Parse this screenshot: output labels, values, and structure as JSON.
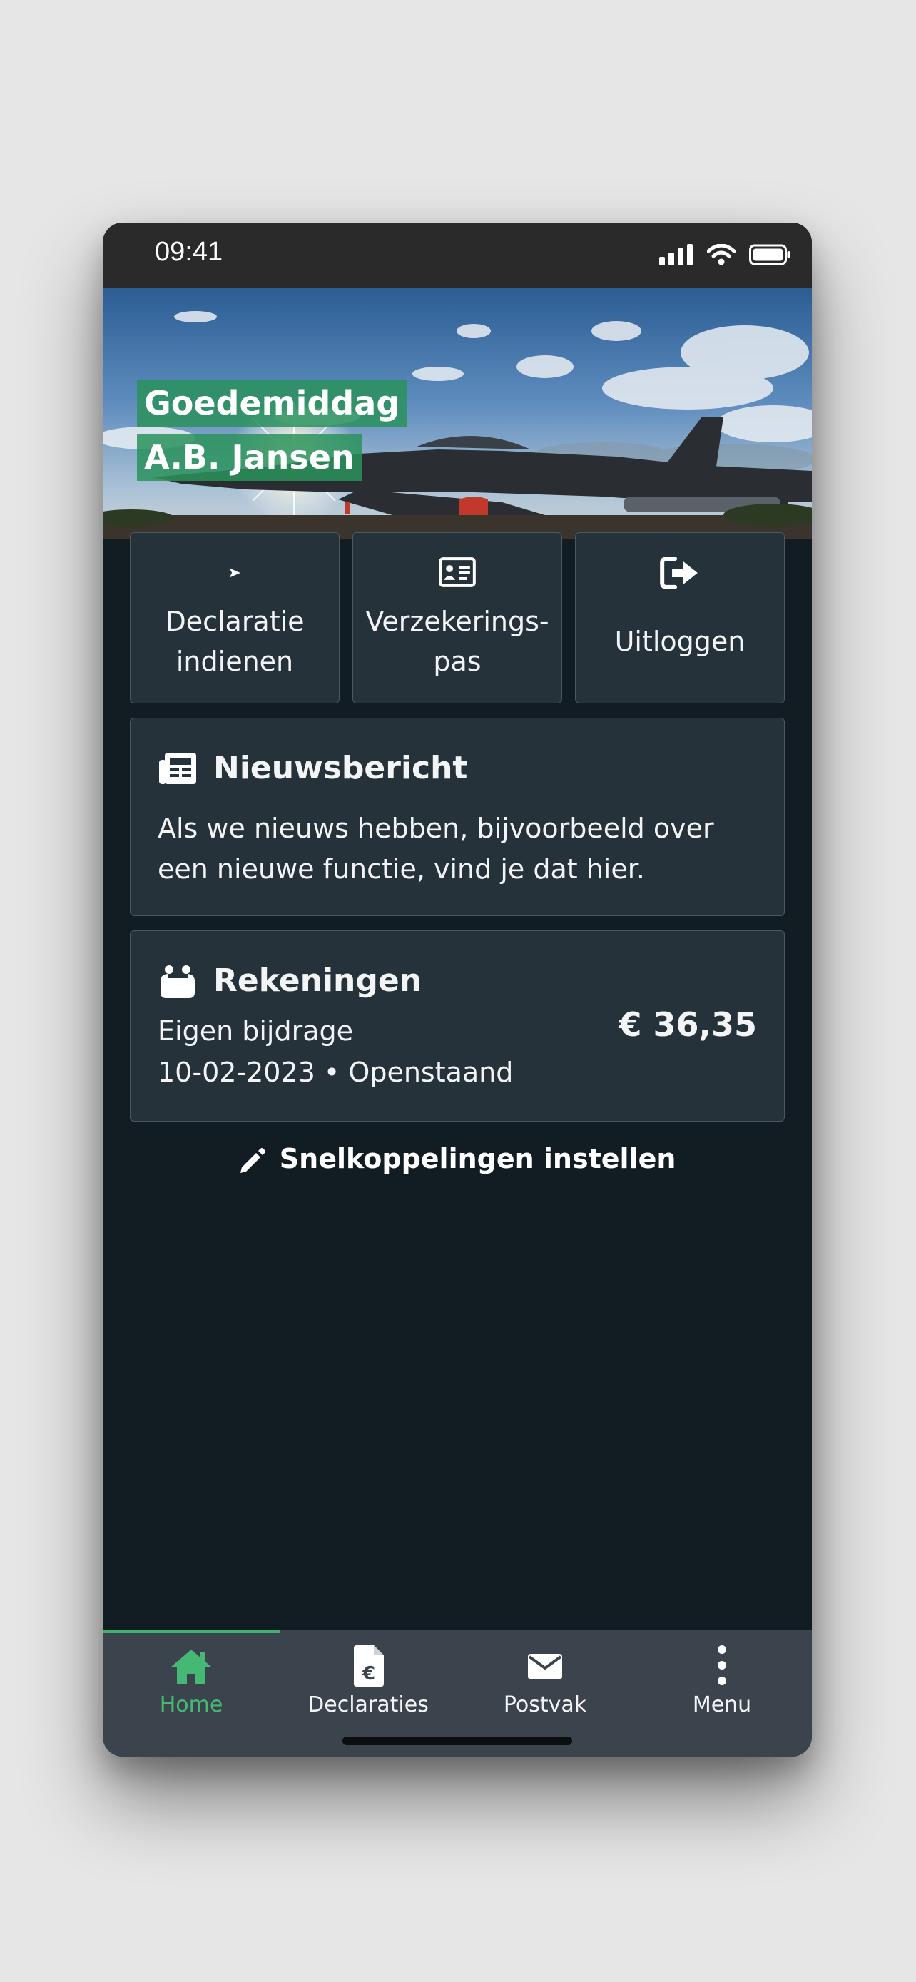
{
  "status_bar": {
    "time": "09:41",
    "icons": [
      "cellular-signal-icon",
      "wifi-icon",
      "battery-icon"
    ]
  },
  "header": {
    "greeting": "Goedemiddag",
    "user_name": "A.B. Jansen"
  },
  "quick_actions": [
    {
      "icon": "paper-plane-icon",
      "label_line1": "Declaratie",
      "label_line2": "indienen"
    },
    {
      "icon": "id-card-icon",
      "label_line1": "Verzekerings-",
      "label_line2": "pas"
    },
    {
      "icon": "sign-out-icon",
      "label": "Uitloggen"
    }
  ],
  "news": {
    "icon": "newspaper-icon",
    "title": "Nieuwsbericht",
    "text": "Als we nieuws hebben, bijvoorbeeld over een nieuwe functie, vind je dat hier."
  },
  "bills": {
    "icon": "piggy-bank-icon",
    "title": "Rekeningen",
    "description": "Eigen bijdrage",
    "meta": "10-02-2023 • Openstaand",
    "amount": "€ 36,35"
  },
  "shortcut_link": {
    "icon": "pencil-icon",
    "label": "Snelkoppelingen instellen"
  },
  "tab_bar": {
    "active": "Home",
    "items": [
      {
        "icon": "home-icon",
        "label": "Home"
      },
      {
        "icon": "euro-document-icon",
        "label": "Declaraties"
      },
      {
        "icon": "envelope-icon",
        "label": "Postvak"
      },
      {
        "icon": "vertical-dots-icon",
        "label": "Menu"
      }
    ]
  },
  "colors": {
    "accent_green": "#3fb070",
    "background": "#121c23",
    "card": "#26323a",
    "tab_bar": "#3b444c"
  }
}
